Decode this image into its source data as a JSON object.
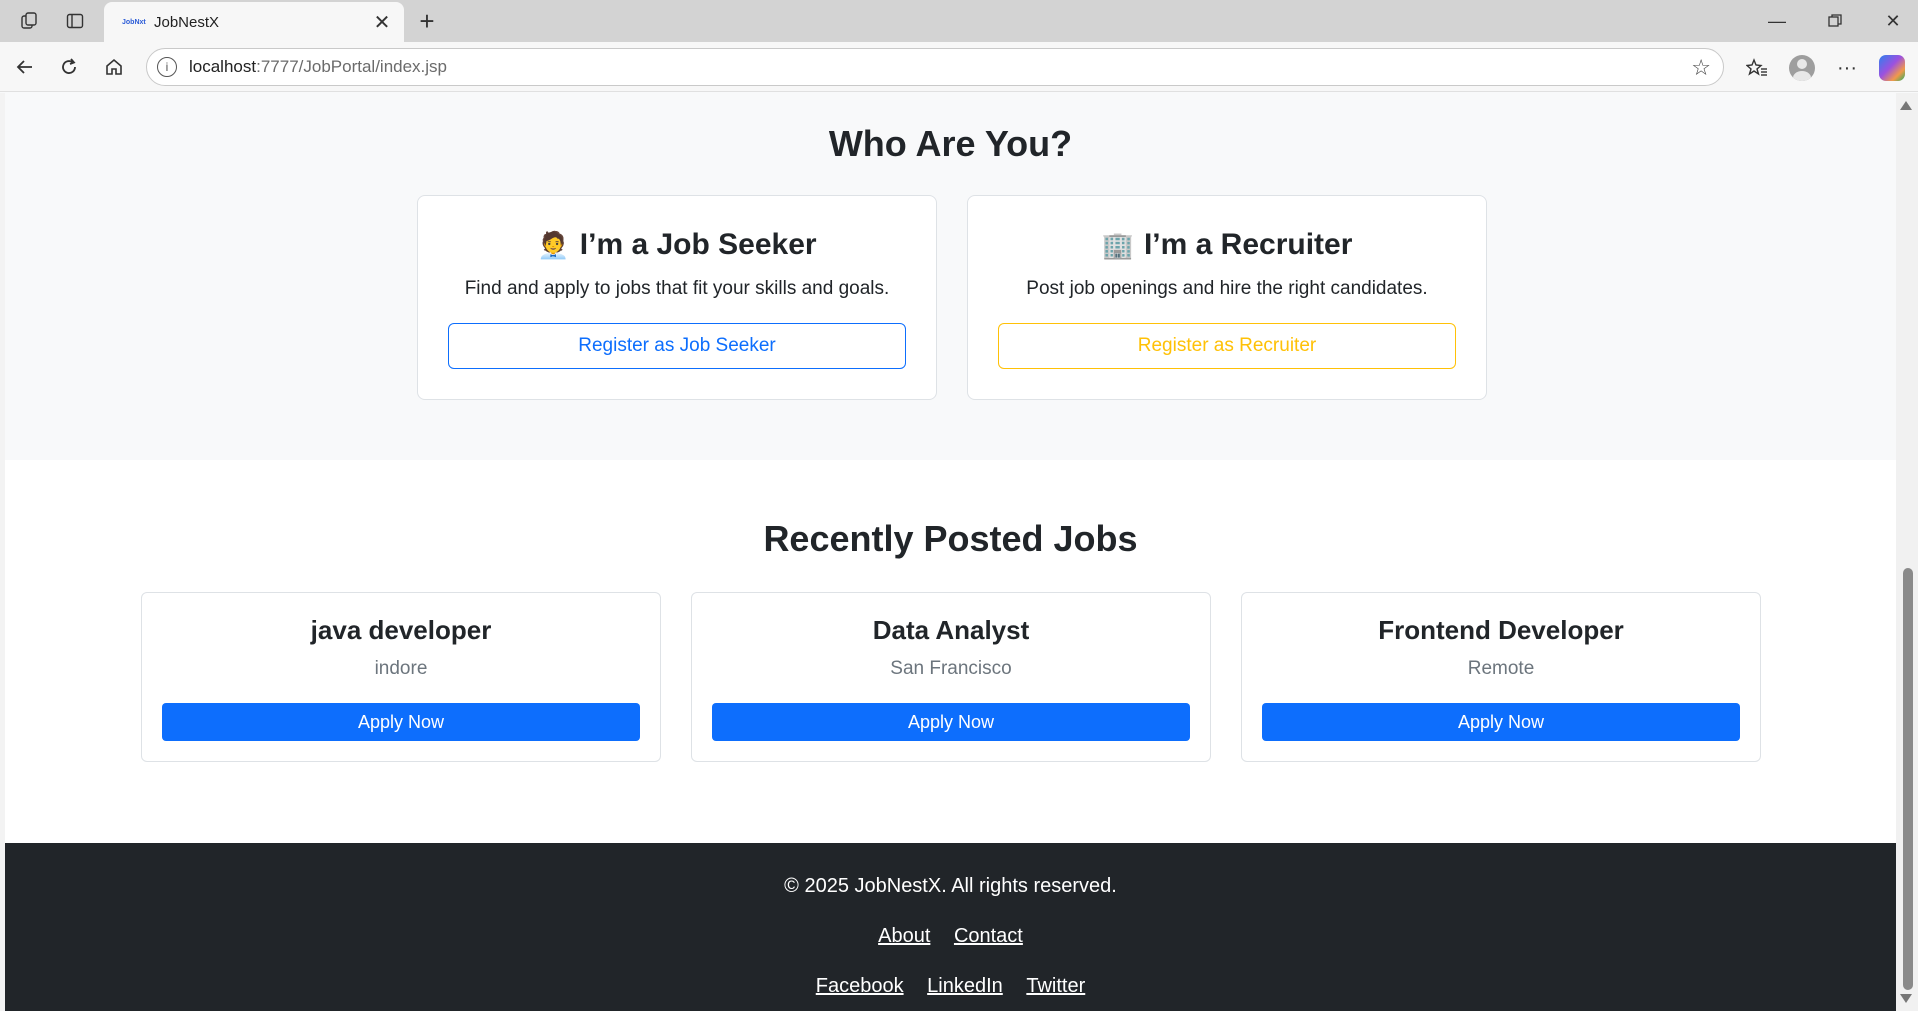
{
  "browser": {
    "tab_title": "JobNestX",
    "tab_favicon_text": "JobNxt",
    "url_host": "localhost",
    "url_path": ":7777/JobPortal/index.jsp"
  },
  "who": {
    "heading": "Who Are You?",
    "seeker": {
      "emoji": "🧑‍💼",
      "title": "I’m a Job Seeker",
      "description": "Find and apply to jobs that fit your skills and goals.",
      "button": "Register as Job Seeker"
    },
    "recruiter": {
      "emoji": "🏢",
      "title": "I’m a Recruiter",
      "description": "Post job openings and hire the right candidates.",
      "button": "Register as Recruiter"
    }
  },
  "jobs": {
    "heading": "Recently Posted Jobs",
    "items": [
      {
        "title": "java developer",
        "location": "indore",
        "button": "Apply Now"
      },
      {
        "title": "Data Analyst",
        "location": "San Francisco",
        "button": "Apply Now"
      },
      {
        "title": "Frontend Developer",
        "location": "Remote",
        "button": "Apply Now"
      }
    ]
  },
  "footer": {
    "copyright": "© 2025 JobNestX. All rights reserved.",
    "links": [
      "About",
      "Contact"
    ],
    "social": [
      "Facebook",
      "LinkedIn",
      "Twitter"
    ]
  },
  "colors": {
    "primary": "#0d6efd",
    "warning": "#ffc107",
    "dark": "#212529",
    "light": "#f8f9fa"
  }
}
